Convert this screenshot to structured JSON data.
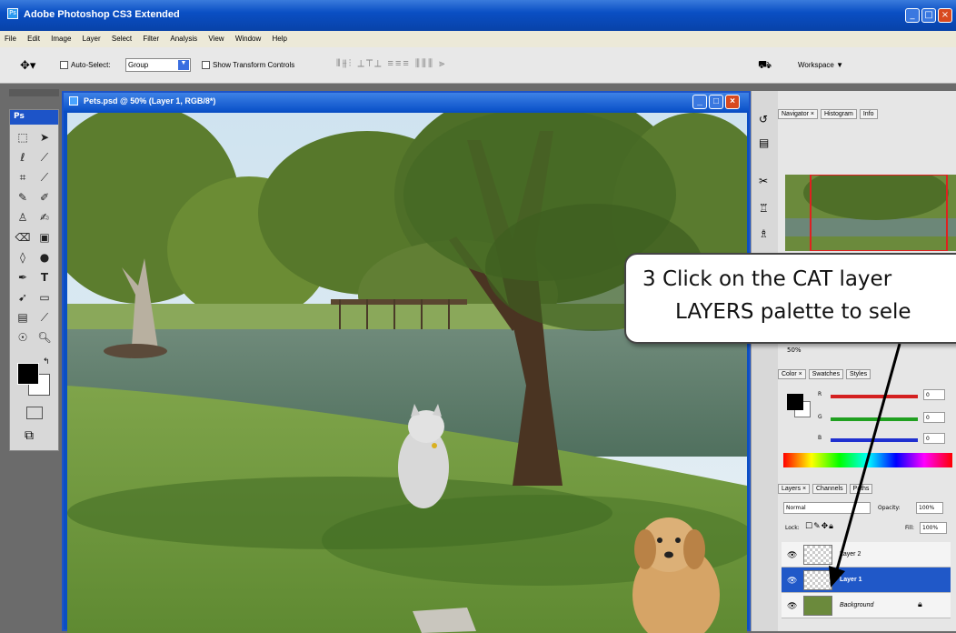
{
  "app": {
    "title": "Adobe Photoshop CS3 Extended"
  },
  "menu": [
    "File",
    "Edit",
    "Image",
    "Layer",
    "Select",
    "Filter",
    "Analysis",
    "View",
    "Window",
    "Help"
  ],
  "options_bar": {
    "auto_select_label": "Auto-Select:",
    "auto_select_value": "Group",
    "show_transform_label": "Show Transform Controls",
    "workspace_label": "Workspace ▼"
  },
  "toolbox": {
    "logo": "Ps"
  },
  "document": {
    "title": "Pets.psd @ 50% (Layer 1, RGB/8*)"
  },
  "navigator": {
    "tabs": [
      "Navigator ×",
      "Histogram",
      "Info"
    ],
    "zoom": "50%"
  },
  "color_panel": {
    "tabs": [
      "Color ×",
      "Swatches",
      "Styles"
    ],
    "channels": [
      {
        "label": "R",
        "value": "0",
        "color": "#d42020"
      },
      {
        "label": "G",
        "value": "0",
        "color": "#20a020"
      },
      {
        "label": "B",
        "value": "0",
        "color": "#2030d0"
      }
    ]
  },
  "layers_panel": {
    "tabs": [
      "Layers ×",
      "Channels",
      "Paths"
    ],
    "blend_mode": "Normal",
    "opacity_label": "Opacity:",
    "opacity_value": "100%",
    "lock_label": "Lock:",
    "fill_label": "Fill:",
    "fill_value": "100%",
    "layers": [
      {
        "name": "Layer 2",
        "selected": false
      },
      {
        "name": "Layer 1",
        "selected": true
      },
      {
        "name": "Background",
        "selected": false
      }
    ]
  },
  "callout": {
    "line1": "3  Click on the CAT layer",
    "line2": "LAYERS palette to sele"
  },
  "colors": {
    "xp_blue": "#0a4fc4",
    "selection": "#2058c8"
  }
}
